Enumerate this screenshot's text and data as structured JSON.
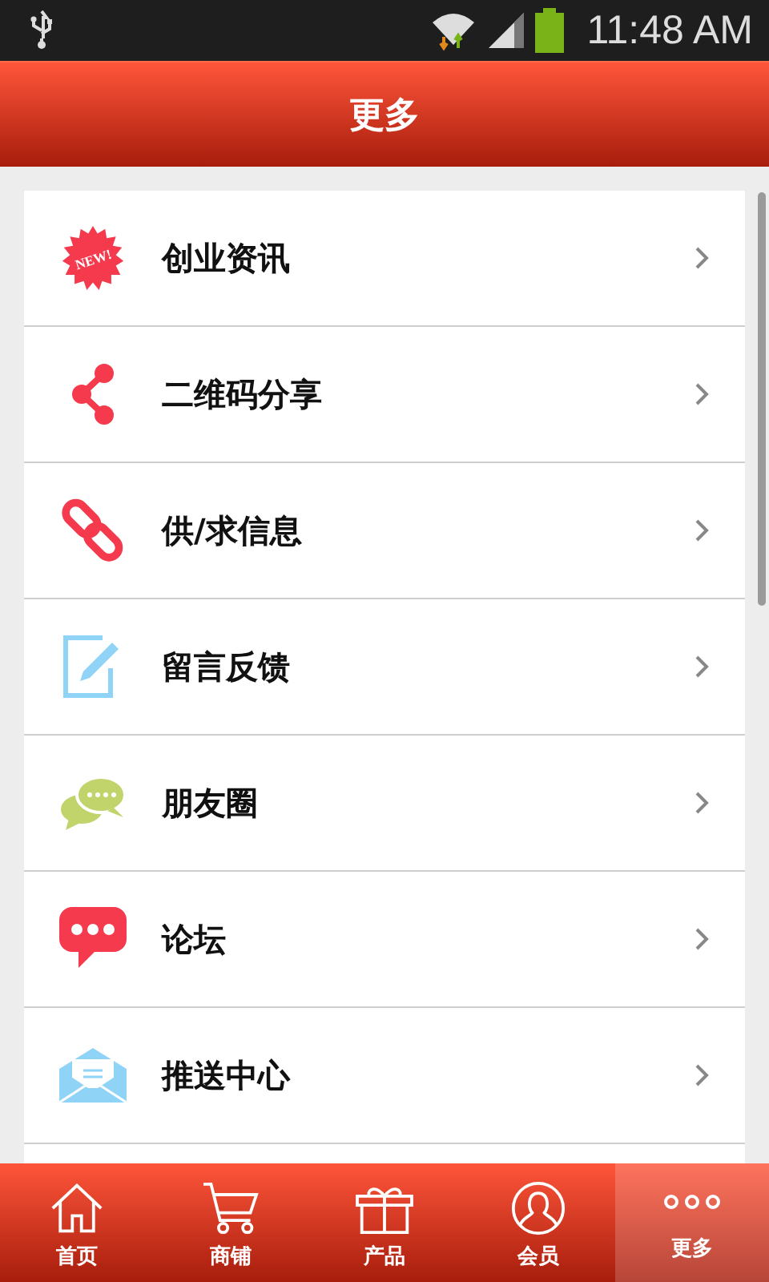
{
  "status_bar": {
    "time": "11:48 AM"
  },
  "header": {
    "title": "更多"
  },
  "menu": [
    {
      "kind": "new",
      "label": "创业资讯",
      "badge": "NEW!"
    },
    {
      "kind": "share",
      "label": "二维码分享"
    },
    {
      "kind": "link",
      "label": "供/求信息"
    },
    {
      "kind": "edit",
      "label": "留言反馈"
    },
    {
      "kind": "chat",
      "label": "朋友圈"
    },
    {
      "kind": "forum",
      "label": "论坛"
    },
    {
      "kind": "mail",
      "label": "推送中心"
    }
  ],
  "tabs": [
    {
      "kind": "home",
      "label": "首页",
      "selected": false
    },
    {
      "kind": "cart",
      "label": "商铺",
      "selected": false
    },
    {
      "kind": "gift",
      "label": "产品",
      "selected": false
    },
    {
      "kind": "user",
      "label": "会员",
      "selected": false
    },
    {
      "kind": "more",
      "label": "更多",
      "selected": true
    }
  ]
}
